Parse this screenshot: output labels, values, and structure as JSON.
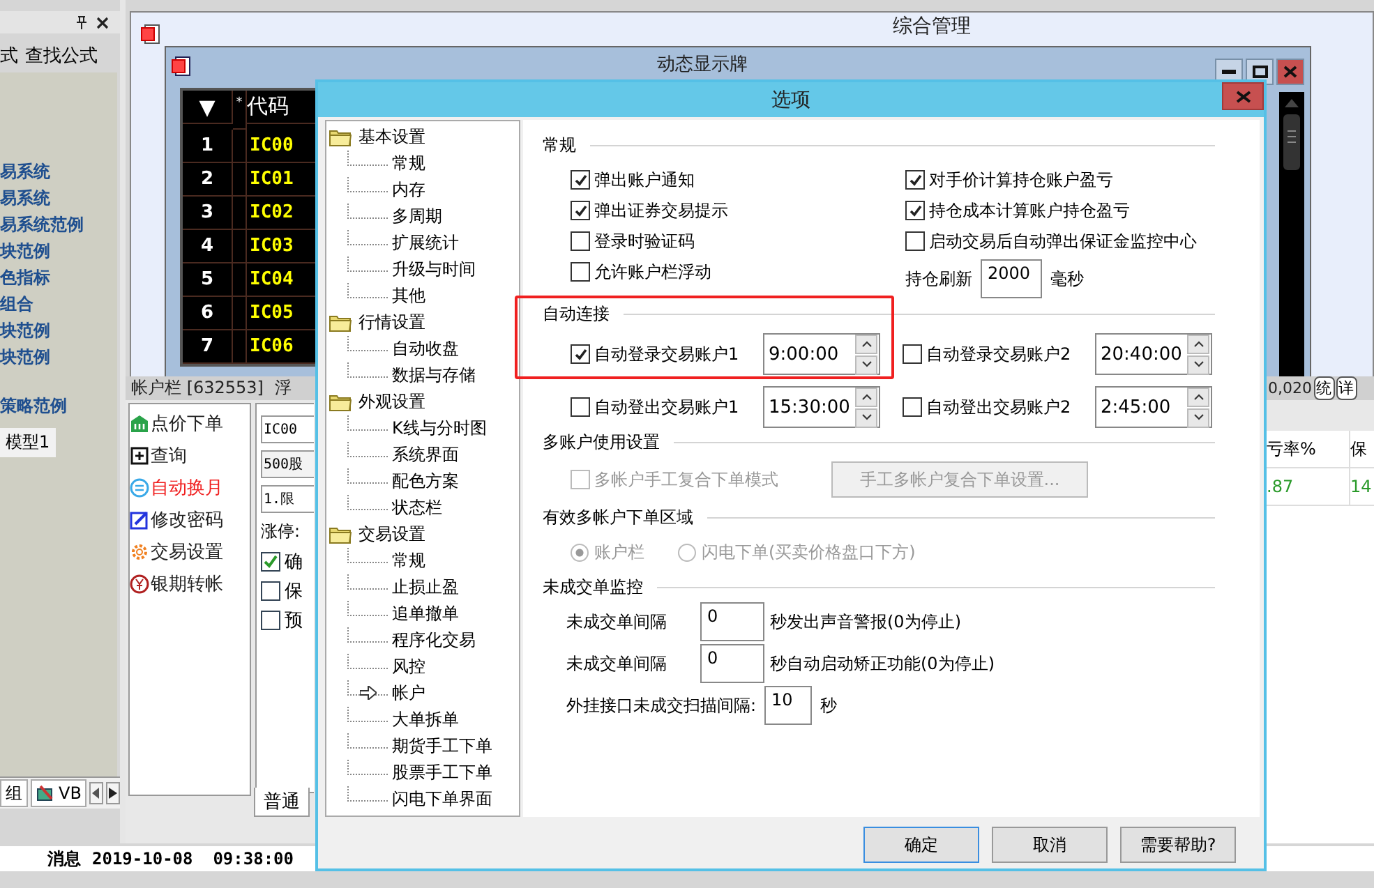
{
  "left_panel": {
    "tabs": [
      {
        "label": "式",
        "selected": false
      },
      {
        "label": "查找公式",
        "selected": false
      }
    ],
    "items": [
      "易系统",
      "易系统",
      "易系统范例",
      "块范例",
      "色指标",
      "组合",
      "块范例",
      "块范例",
      "策略范例"
    ],
    "model_tab": "模型1",
    "bottom_tabs": [
      {
        "label": "组",
        "kind": "text"
      },
      {
        "label": "VB",
        "kind": "icon"
      }
    ]
  },
  "main_window": {
    "title": "综合管理"
  },
  "board_window": {
    "title": "动态显示牌",
    "columns": [
      "▼",
      "*",
      "代码"
    ],
    "rows": [
      {
        "no": "1",
        "code": "IC00"
      },
      {
        "no": "2",
        "code": "IC01"
      },
      {
        "no": "3",
        "code": "IC02"
      },
      {
        "no": "4",
        "code": "IC03"
      },
      {
        "no": "5",
        "code": "IC04"
      },
      {
        "no": "6",
        "code": "IC05"
      },
      {
        "no": "7",
        "code": "IC06"
      }
    ]
  },
  "account_bar": {
    "title": "帐户栏 [632553]",
    "float_label": "浮",
    "menu": [
      {
        "label": "点价下单",
        "selected": false
      },
      {
        "label": "查询",
        "selected": false
      },
      {
        "label": "自动换月",
        "selected": true
      },
      {
        "label": "修改密码",
        "selected": false
      },
      {
        "label": "交易设置",
        "selected": false
      },
      {
        "label": "银期转帐",
        "selected": false
      }
    ],
    "form": {
      "code": "IC00",
      "amount": "500股",
      "order_type": "1.限",
      "limit_label": "涨停:",
      "checks": [
        {
          "label": "确",
          "checked": true
        },
        {
          "label": "保",
          "checked": false
        },
        {
          "label": "预",
          "checked": false
        }
      ]
    },
    "tab": "普通",
    "summary": "0,020",
    "buttons": [
      "统",
      "详"
    ],
    "table": {
      "columns": [
        "亏率%",
        "保"
      ],
      "rows": [
        [
          ".87",
          "14"
        ]
      ]
    }
  },
  "dialog": {
    "title": "选项",
    "tree": [
      {
        "label": "基本设置",
        "children": [
          {
            "label": "常规",
            "selected": false
          },
          {
            "label": "内存",
            "selected": false
          },
          {
            "label": "多周期",
            "selected": false
          },
          {
            "label": "扩展统计",
            "selected": false
          },
          {
            "label": "升级与时间",
            "selected": false
          },
          {
            "label": "其他",
            "selected": false
          }
        ]
      },
      {
        "label": "行情设置",
        "children": [
          {
            "label": "自动收盘",
            "selected": false
          },
          {
            "label": "数据与存储",
            "selected": false
          }
        ]
      },
      {
        "label": "外观设置",
        "children": [
          {
            "label": "K线与分时图",
            "selected": false
          },
          {
            "label": "系统界面",
            "selected": false
          },
          {
            "label": "配色方案",
            "selected": false
          },
          {
            "label": "状态栏",
            "selected": false
          }
        ]
      },
      {
        "label": "交易设置",
        "children": [
          {
            "label": "常规",
            "selected": false
          },
          {
            "label": "止损止盈",
            "selected": false
          },
          {
            "label": "追单撤单",
            "selected": false
          },
          {
            "label": "程序化交易",
            "selected": false
          },
          {
            "label": "风控",
            "selected": false
          },
          {
            "label": "帐户",
            "selected": true
          },
          {
            "label": "大单拆单",
            "selected": false
          },
          {
            "label": "期货手工下单",
            "selected": false
          },
          {
            "label": "股票手工下单",
            "selected": false
          },
          {
            "label": "闪电下单界面",
            "selected": false
          }
        ]
      }
    ],
    "sections": [
      {
        "kind": "grid",
        "title": "常规",
        "left": [
          {
            "label": "弹出账户通知",
            "checked": true
          },
          {
            "label": "弹出证券交易提示",
            "checked": true
          },
          {
            "label": "登录时验证码",
            "checked": false
          },
          {
            "label": "允许账户栏浮动",
            "checked": false
          }
        ],
        "right": [
          {
            "label": "对手价计算持仓账户盈亏",
            "checked": true
          },
          {
            "label": "持仓成本计算账户持仓盈亏",
            "checked": true
          },
          {
            "label": "启动交易后自动弹出保证金监控中心",
            "checked": false
          }
        ],
        "refresh": {
          "label": "持仓刷新",
          "value": "2000",
          "unit": "毫秒"
        }
      },
      {
        "kind": "schedule",
        "title": "自动连接",
        "highlighted": true,
        "rows": [
          [
            {
              "label": "自动登录交易账户1",
              "checked": true,
              "time": "9:00:00"
            },
            {
              "label": "自动登录交易账户2",
              "checked": false,
              "time": "20:40:00"
            }
          ],
          [
            {
              "label": "自动登出交易账户1",
              "checked": false,
              "time": "15:30:00"
            },
            {
              "label": "自动登出交易账户2",
              "checked": false,
              "time": "2:45:00"
            }
          ]
        ]
      },
      {
        "kind": "multi",
        "title": "多账户使用设置",
        "check": {
          "label": "多帐户手工复合下单模式",
          "checked": false,
          "disabled": true
        },
        "button": {
          "label": "手工多帐户复合下单设置...",
          "disabled": true
        }
      },
      {
        "kind": "radios",
        "title": "有效多帐户下单区域",
        "disabled": true,
        "options": [
          {
            "label": "账户栏",
            "selected": true
          },
          {
            "label": "闪电下单(买卖价格盘口下方)",
            "selected": false
          }
        ]
      },
      {
        "kind": "monitor",
        "title": "未成交单监控",
        "rows": [
          {
            "label": "未成交单间隔",
            "value": "0",
            "suffix": "秒发出声音警报(0为停止)"
          },
          {
            "label": "未成交单间隔",
            "value": "0",
            "suffix": "秒自动启动矫正功能(0为停止)"
          },
          {
            "label": "外挂接口未成交扫描间隔:",
            "value": "10",
            "suffix": "秒"
          }
        ]
      }
    ],
    "buttons": [
      {
        "label": "确定",
        "default": true
      },
      {
        "label": "取消",
        "default": false
      },
      {
        "label": "需要帮助?",
        "default": false
      }
    ]
  },
  "status_bar": {
    "label": "消息",
    "time": "2019-10-08  09:38:00"
  }
}
